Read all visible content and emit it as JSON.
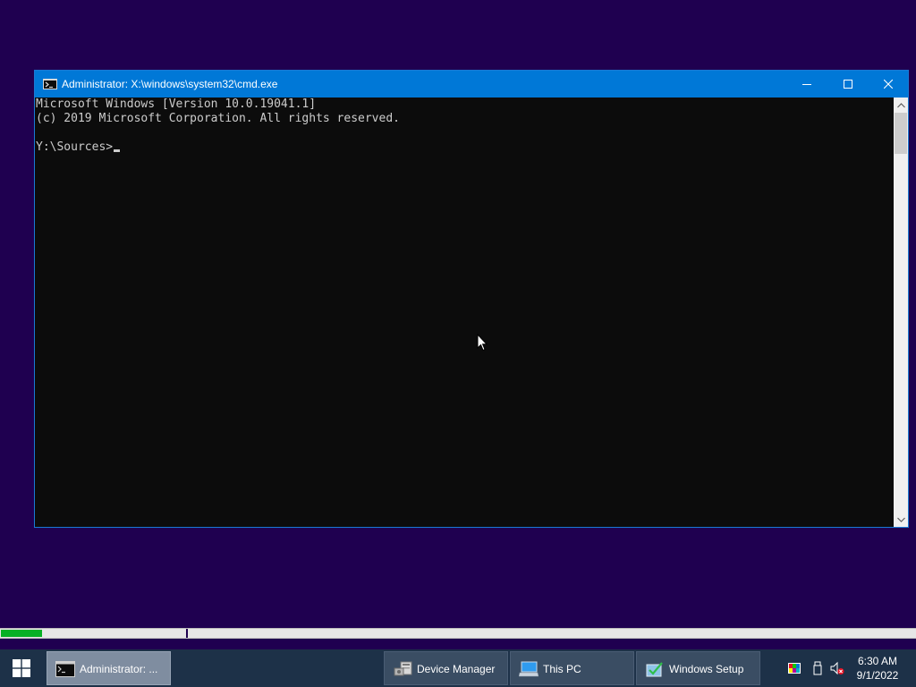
{
  "window": {
    "title": "Administrator: X:\\windows\\system32\\cmd.exe",
    "controls": {
      "minimize": "minimize",
      "maximize": "maximize",
      "close": "close"
    }
  },
  "console": {
    "lines": [
      "Microsoft Windows [Version 10.0.19041.1]",
      "(c) 2019 Microsoft Corporation. All rights reserved.",
      "",
      "Y:\\Sources>"
    ]
  },
  "progress": {
    "fill_fraction": 0.045,
    "marker_fraction": 0.203
  },
  "taskbar": {
    "buttons": [
      {
        "label": "Administrator: ...",
        "icon": "cmd-icon",
        "active": true
      },
      {
        "label": "Device Manager",
        "icon": "device-manager-icon",
        "active": false
      },
      {
        "label": "This PC",
        "icon": "this-pc-icon",
        "active": false
      },
      {
        "label": "Windows Setup",
        "icon": "windows-setup-icon",
        "active": false
      }
    ],
    "tray": {
      "icons": [
        "color-display-icon",
        "usb-icon",
        "volume-muted-icon"
      ],
      "time": "6:30 AM",
      "date": "9/1/2022"
    }
  },
  "colors": {
    "desktop": "#1f0050",
    "titlebar": "#0078d7",
    "console_bg": "#0c0c0c",
    "console_text": "#cccccc",
    "taskbar": "#1d3148",
    "progress": "#06b025"
  }
}
